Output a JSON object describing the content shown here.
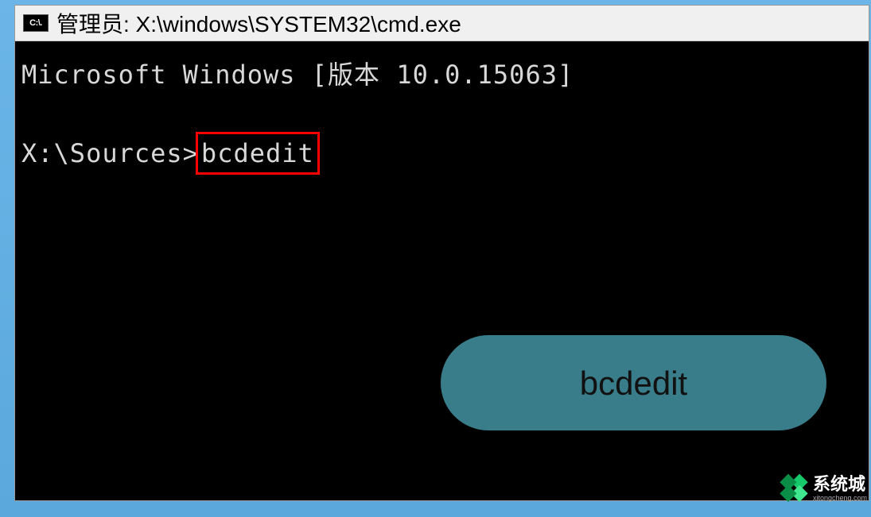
{
  "titlebar": {
    "icon_label": "C:\\.",
    "text": "管理员: X:\\windows\\SYSTEM32\\cmd.exe"
  },
  "terminal": {
    "line1": "Microsoft Windows [版本 10.0.15063]",
    "prompt": "X:\\Sources>",
    "command": "bcdedit"
  },
  "callout": {
    "label": "bcdedit"
  },
  "watermark": {
    "main": "系统城",
    "sub": "xitongcheng.com"
  }
}
